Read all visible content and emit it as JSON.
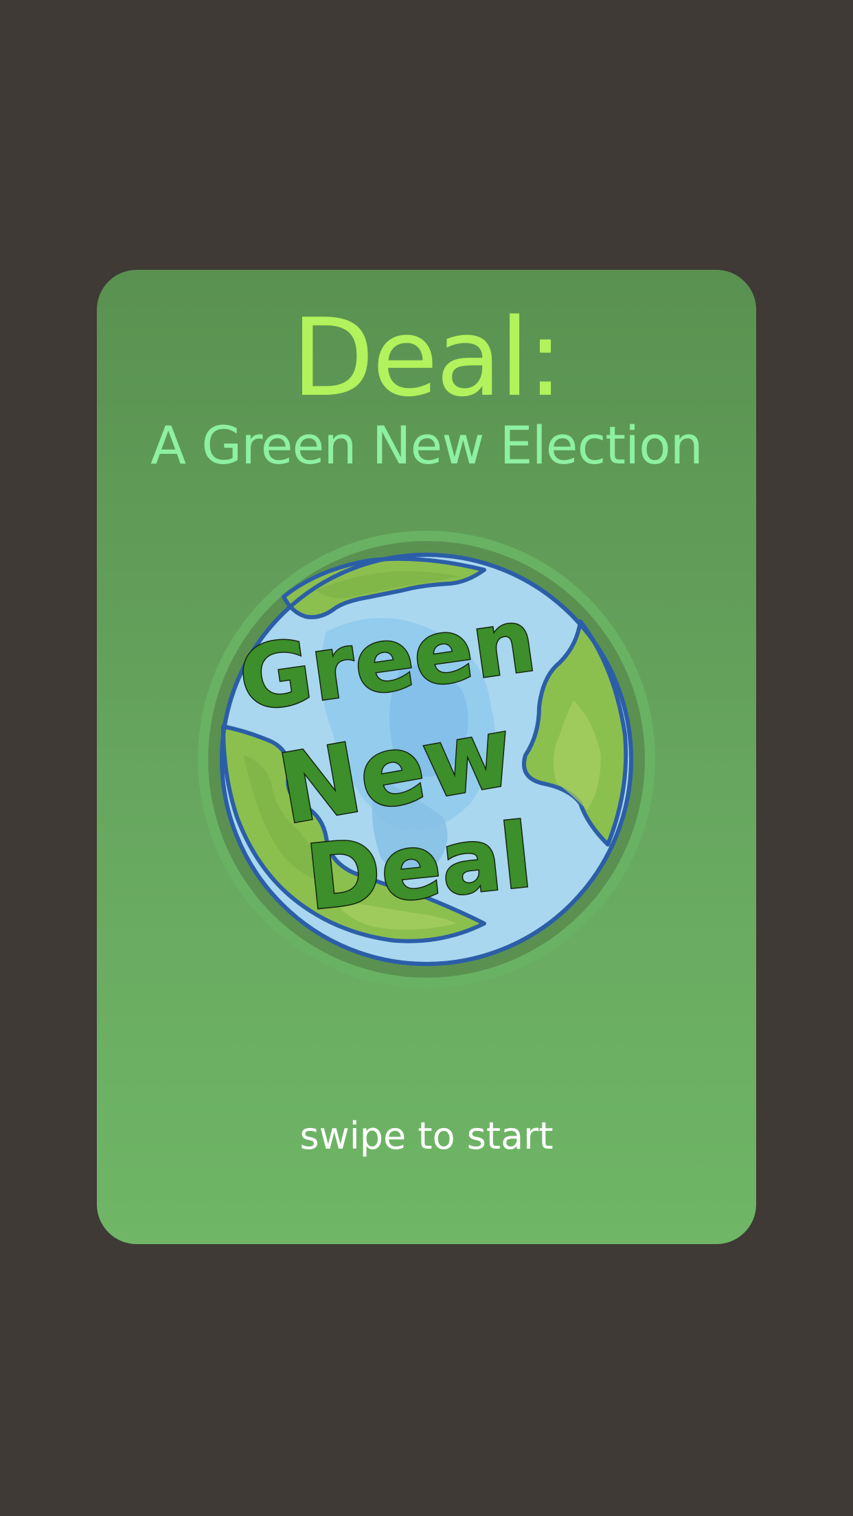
{
  "app": {
    "title": "Deal:",
    "subtitle": "A Green New Election"
  },
  "logo": {
    "icon": "earth-globe-icon",
    "lines": [
      "Green",
      "New",
      "Deal"
    ]
  },
  "prompt": {
    "label": "swipe to start"
  },
  "colors": {
    "background": "#3f3a36",
    "card": "#65a55d",
    "title": "#b2f25c",
    "subtitle": "#8df0a2",
    "ocean": "#a8d8f0",
    "land": "#8cc04e",
    "logo_text": "#3c8f2a"
  }
}
